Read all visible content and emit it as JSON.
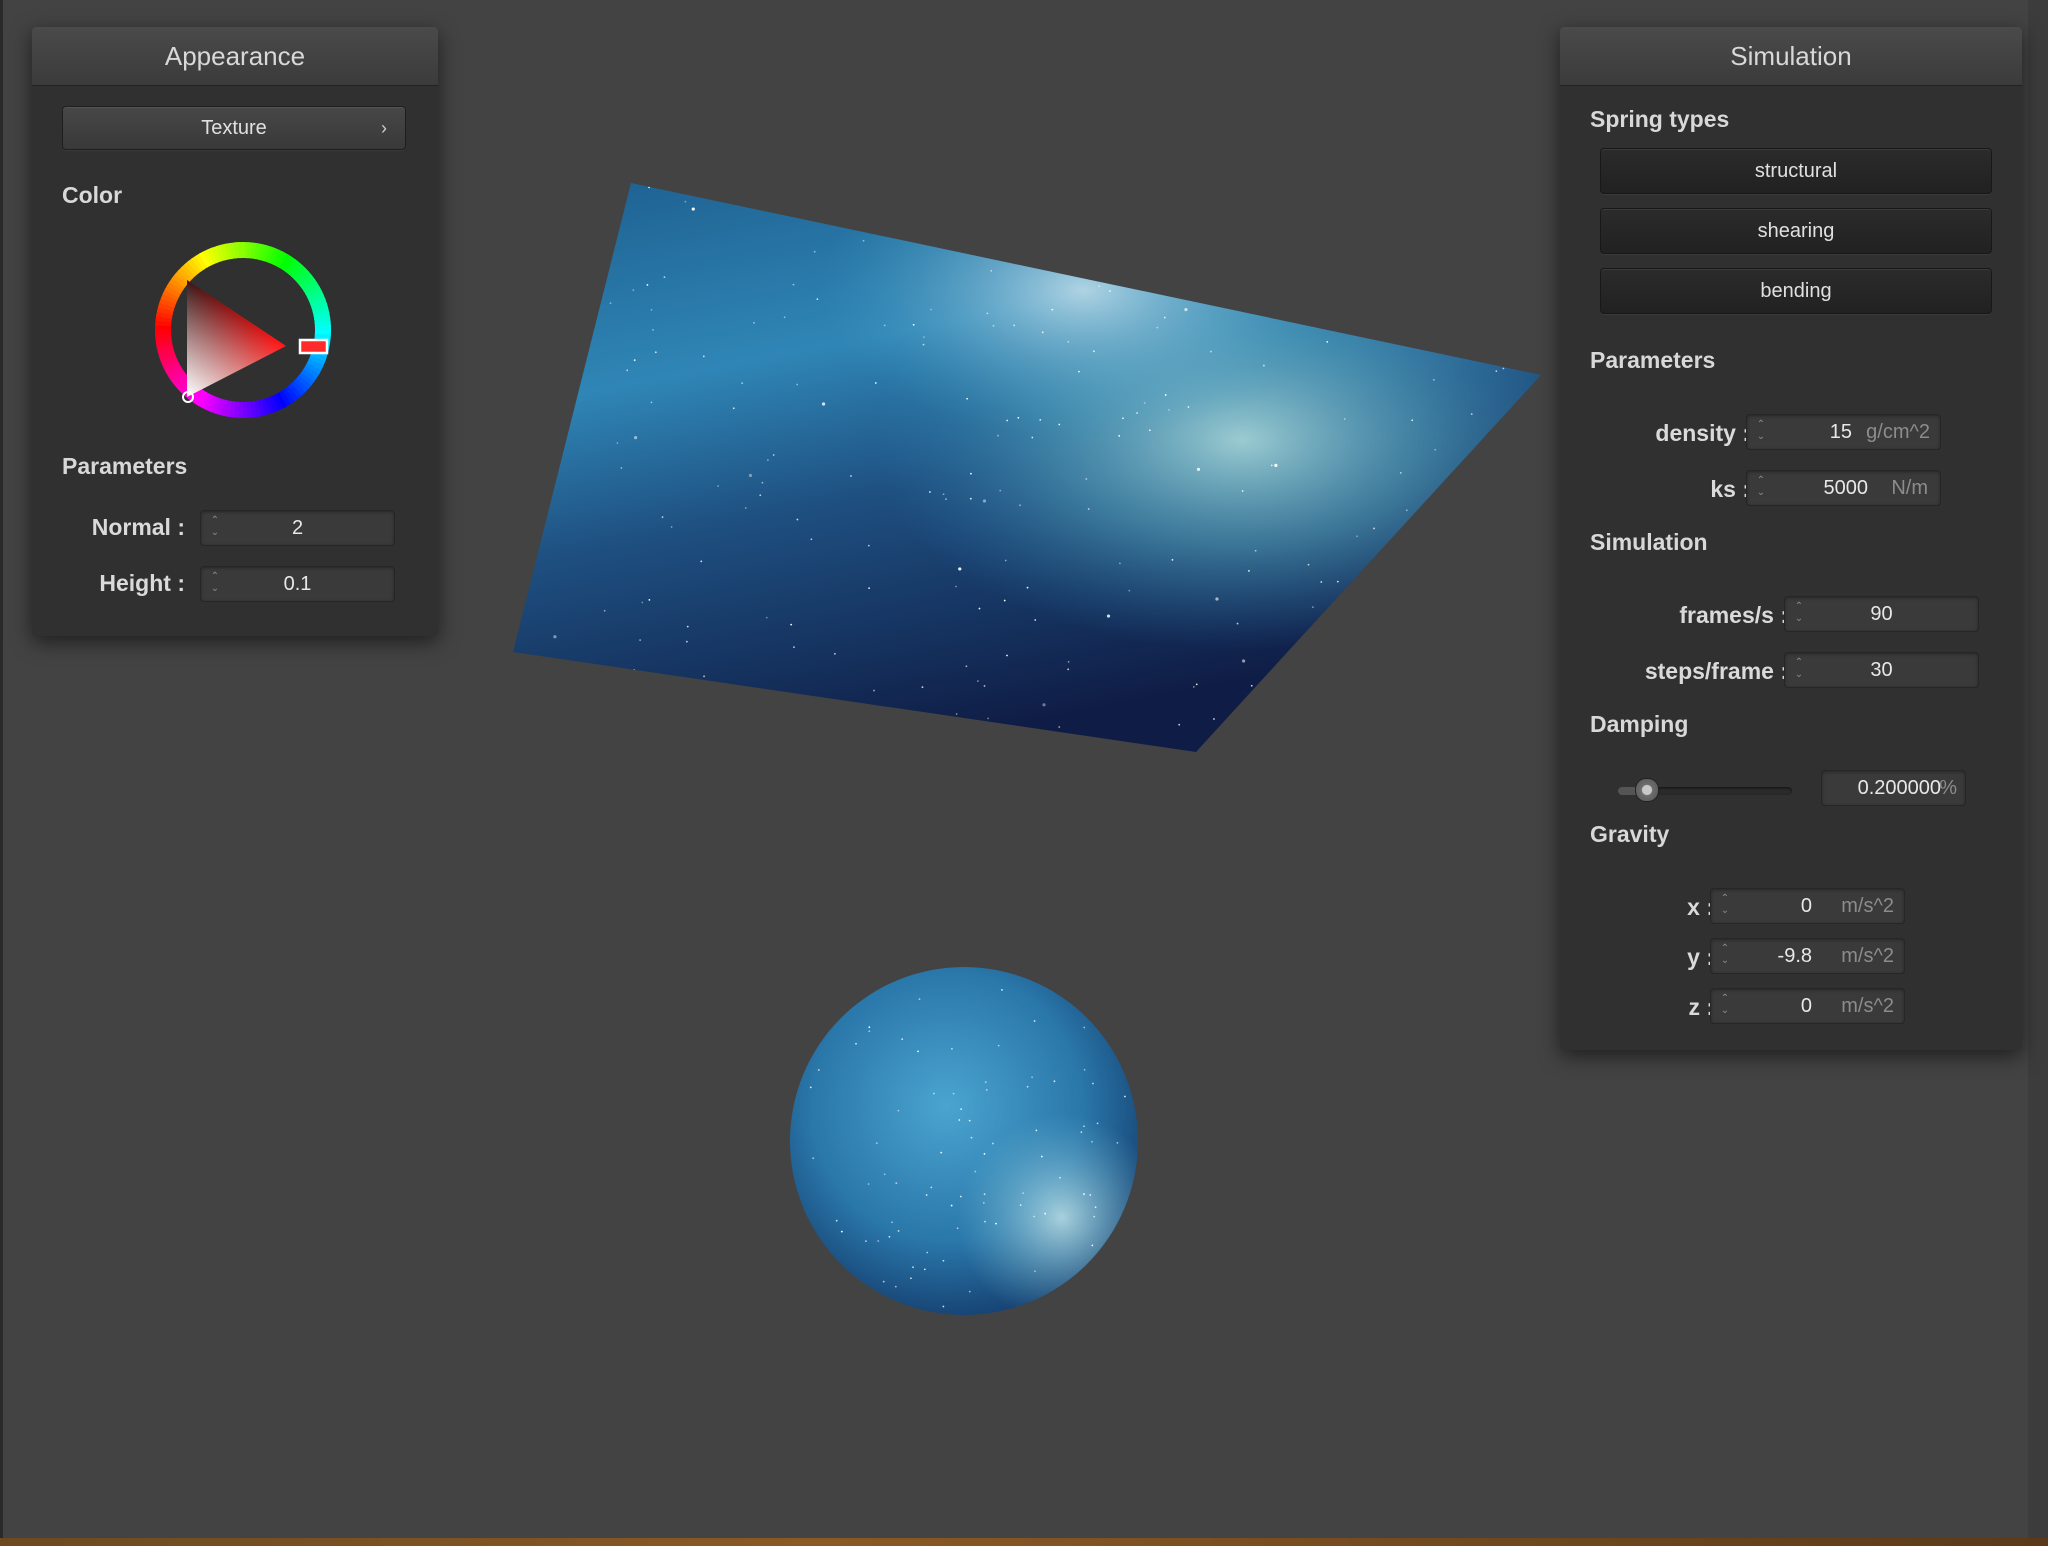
{
  "appearance": {
    "title": "Appearance",
    "texture_button": "Texture",
    "color_label": "Color",
    "parameters_label": "Parameters",
    "normal": {
      "label": "Normal :",
      "value": "2"
    },
    "height": {
      "label": "Height :",
      "value": "0.1"
    }
  },
  "simulation": {
    "title": "Simulation",
    "spring_types_label": "Spring types",
    "spring_types": [
      "structural",
      "shearing",
      "bending"
    ],
    "parameters_label": "Parameters",
    "density": {
      "label": "density :",
      "value": "15",
      "unit": "g/cm^2"
    },
    "ks": {
      "label": "ks :",
      "value": "5000",
      "unit": "N/m"
    },
    "simulation_label": "Simulation",
    "frames_per_s": {
      "label": "frames/s :",
      "value": "90"
    },
    "steps_per_frame": {
      "label": "steps/frame :",
      "value": "30"
    },
    "damping_label": "Damping",
    "damping": {
      "value": "0.200000",
      "unit": "%",
      "slider_fraction": 0.1
    },
    "gravity_label": "Gravity",
    "gravity": {
      "x": {
        "label": "x :",
        "value": "0",
        "unit": "m/s^2"
      },
      "y": {
        "label": "y :",
        "value": "-9.8",
        "unit": "m/s^2"
      },
      "z": {
        "label": "z :",
        "value": "0",
        "unit": "m/s^2"
      }
    }
  },
  "icons": {
    "chevron": "chevron-right-icon",
    "spinner": "spinner-arrows-icon"
  },
  "colors": {
    "background": "#434343",
    "panel": "#303030",
    "selected_color": "#ff2020"
  }
}
